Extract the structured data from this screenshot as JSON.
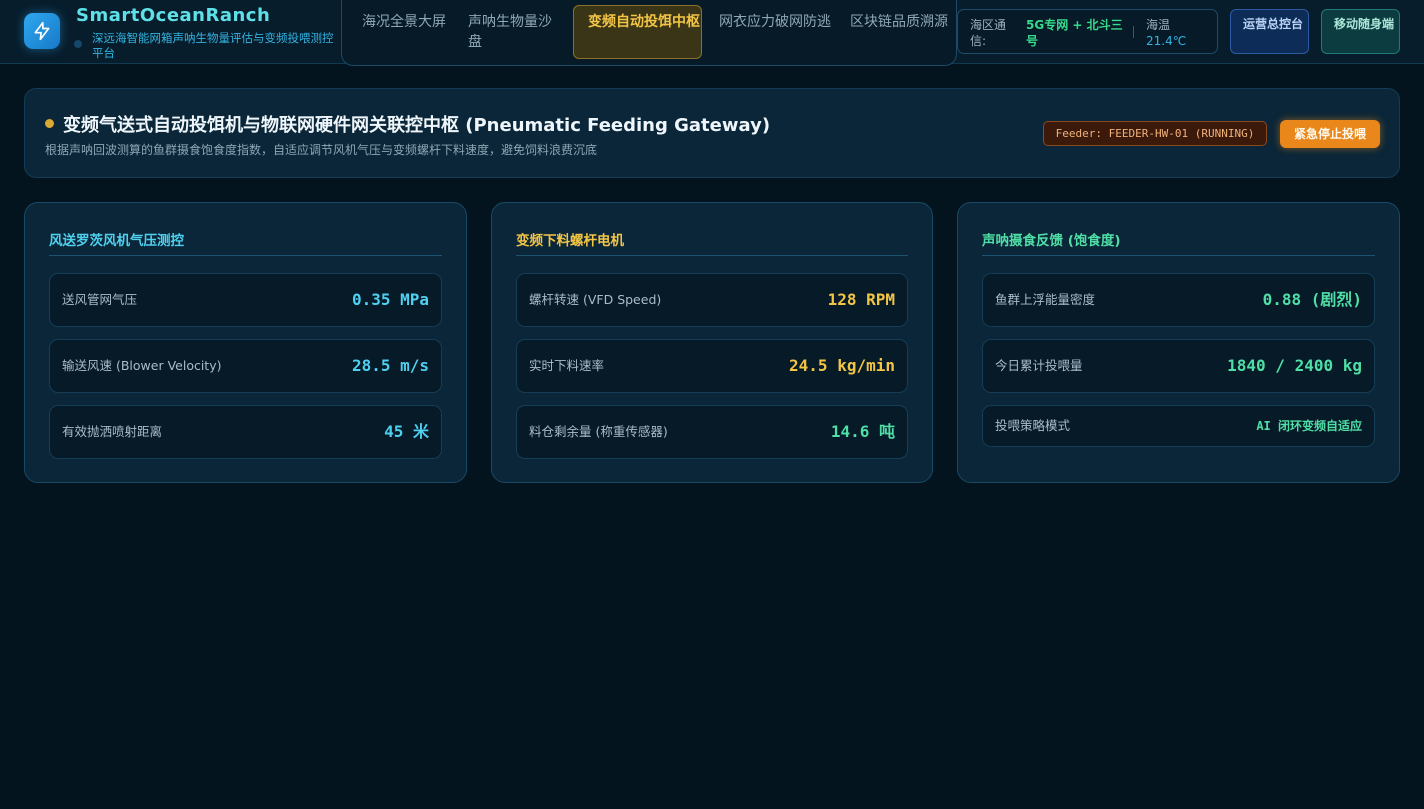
{
  "brand": {
    "title": "SmartOceanRanch",
    "subtitle": "深远海智能网箱声呐生物量评估与变频投喂测控平台"
  },
  "nav": [
    {
      "label": "海况全景大屏"
    },
    {
      "label": "声呐生物量沙盘"
    },
    {
      "label": "变频自动投饵中枢",
      "active": true
    },
    {
      "label": "网衣应力破网防逃"
    },
    {
      "label": "区块链品质溯源"
    }
  ],
  "status": {
    "comm_label": "海区通信:",
    "comm_value": "5G专网 + 北斗三号",
    "temp_label": "海温",
    "temp_value": "21.4℃"
  },
  "top_buttons": {
    "ops": "运营总控台",
    "mobile": "移动随身端"
  },
  "header": {
    "title": "变频气送式自动投饵机与物联网硬件网关联控中枢 (Pneumatic Feeding Gateway)",
    "subtitle": "根据声呐回波测算的鱼群摄食饱食度指数，自适应调节风机气压与变频螺杆下料速度，避免饲料浪费沉底",
    "feeder_badge": "Feeder: FEEDER-HW-01 (RUNNING)",
    "stop_button": "紧急停止投喂"
  },
  "panels": [
    {
      "title": "风送罗茨风机气压测控",
      "title_color": "#4fd0ef",
      "metrics": [
        {
          "label": "送风管网气压",
          "value": "0.35 MPa"
        },
        {
          "label": "输送风速 (Blower Velocity)",
          "value": "28.5 m/s"
        },
        {
          "label": "有效抛洒喷射距离",
          "value": "45 米"
        }
      ]
    },
    {
      "title": "变频下料螺杆电机",
      "title_color": "#f3c545",
      "metrics": [
        {
          "label": "螺杆转速 (VFD Speed)",
          "value": "128 RPM"
        },
        {
          "label": "实时下料速率",
          "value": "24.5 kg/min"
        },
        {
          "label": "料仓剩余量 (称重传感器)",
          "value": "14.6 吨"
        }
      ]
    },
    {
      "title": "声呐摄食反馈 (饱食度)",
      "title_color": "#4fdfa6",
      "metrics": [
        {
          "label": "鱼群上浮能量密度",
          "value": "0.88 (剧烈)"
        },
        {
          "label": "今日累计投喂量",
          "value": "1840 / 2400 kg"
        },
        {
          "label": "投喂策略模式",
          "value": "AI 闭环变频自适应"
        }
      ]
    }
  ]
}
